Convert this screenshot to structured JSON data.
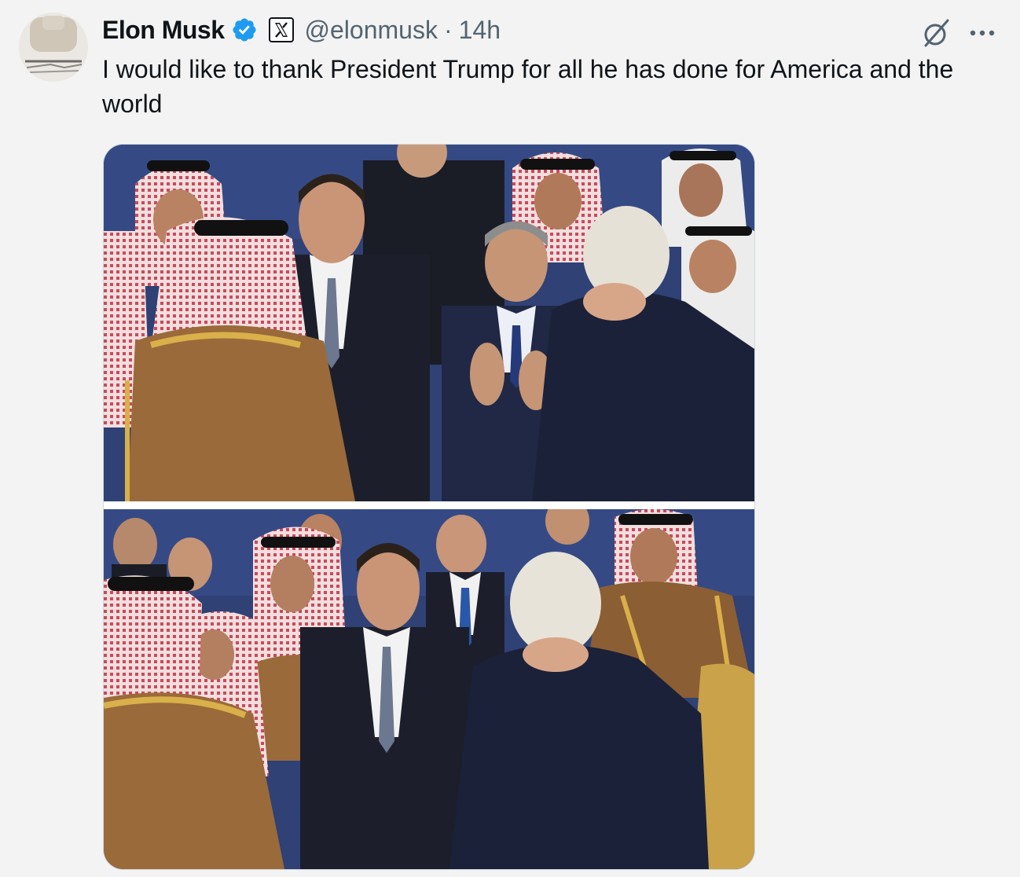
{
  "tweet": {
    "author_name": "Elon Musk",
    "handle": "@elonmusk",
    "separator": "·",
    "time": "14h",
    "text": "I would like to thank President Trump for all he has done for America and the world"
  },
  "icons": {
    "verified": "verified-badge-icon",
    "affiliate": "x-logo-icon",
    "grok": "grok-icon",
    "more": "more-icon"
  },
  "colors": {
    "verified_blue": "#1d9bf0",
    "text_primary": "#0f1419",
    "text_secondary": "#536471",
    "background": "#f3f3f3"
  }
}
